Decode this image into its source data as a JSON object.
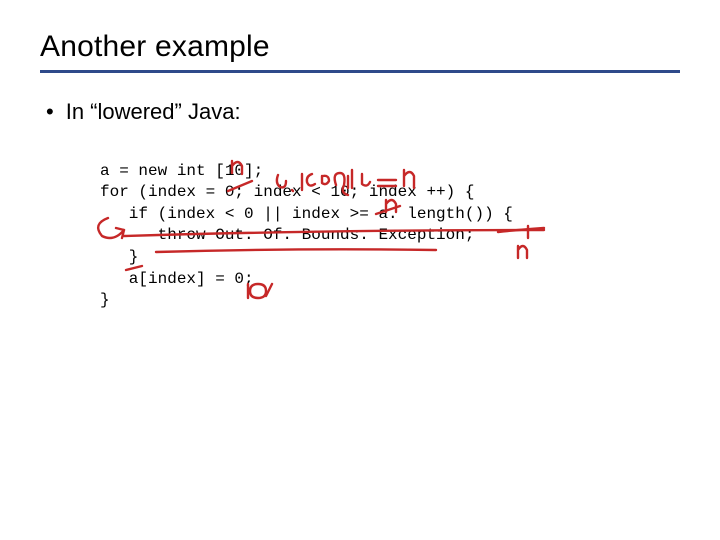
{
  "title": "Another example",
  "bullet": "In “lowered” Java:",
  "code_lines": [
    "a = new int [10];",
    "for (index = 0; index < 10; index ++) {",
    "   if (index < 0 || index >= a. length()) {",
    "      throw Out. Of. Bounds. Exception;",
    "   }",
    "   a[index] = 0;",
    "}"
  ],
  "annotations": {
    "n_over_10_line1": "n",
    "a_length_eq_n": "a . length = n",
    "n_over_10_line2": "n",
    "n_in_length_call": "n",
    "ten_over_zero": "10",
    "strike_10_line1": true,
    "strike_10_line2": true,
    "strike_if_clause": true,
    "strike_throw": true,
    "strike_closing_brace": true,
    "arrow_to_for": true
  },
  "ink_color": "#c62828"
}
